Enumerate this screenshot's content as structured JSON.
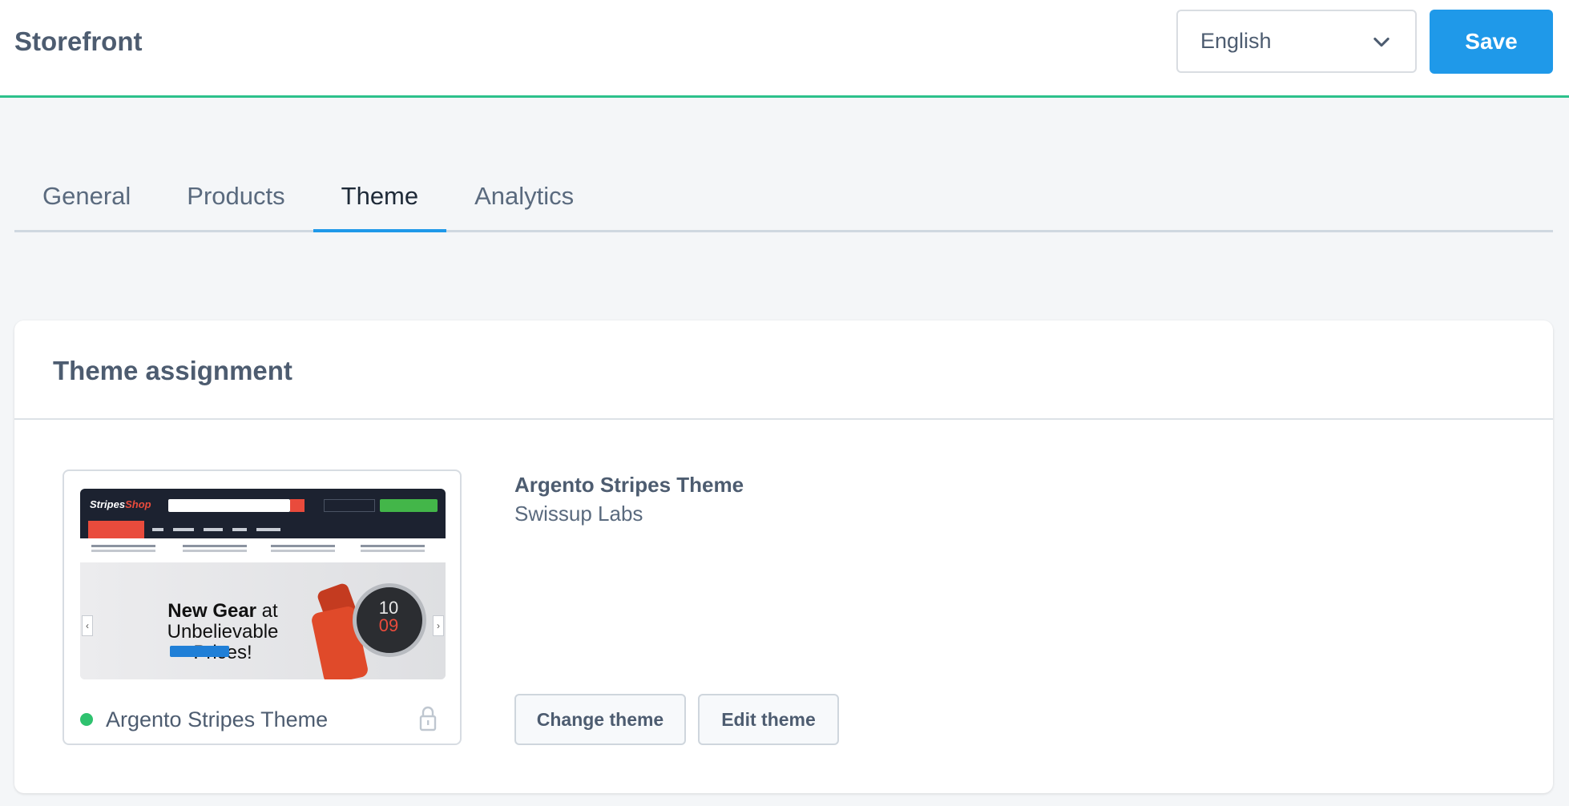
{
  "header": {
    "title": "Storefront",
    "language": "English",
    "save_label": "Save"
  },
  "tabs": [
    {
      "label": "General",
      "active": false
    },
    {
      "label": "Products",
      "active": false
    },
    {
      "label": "Theme",
      "active": true
    },
    {
      "label": "Analytics",
      "active": false
    }
  ],
  "card": {
    "title": "Theme assignment",
    "tile": {
      "name": "Argento Stripes Theme",
      "status": "active",
      "status_color": "#2fc26f",
      "preview": {
        "logo_white": "Stripes",
        "logo_red": "Shop",
        "headline_bold": "New Gear",
        "headline_rest": " at",
        "headline_line2": "Unbelievable Prices!",
        "watch_hours": "10",
        "watch_minutes": "09"
      }
    },
    "info": {
      "name": "Argento Stripes Theme",
      "vendor": "Swissup Labs"
    },
    "change_theme_label": "Change theme",
    "edit_theme_label": "Edit theme"
  },
  "colors": {
    "accent": "#1f99e9",
    "header_border": "#2dc18b"
  }
}
